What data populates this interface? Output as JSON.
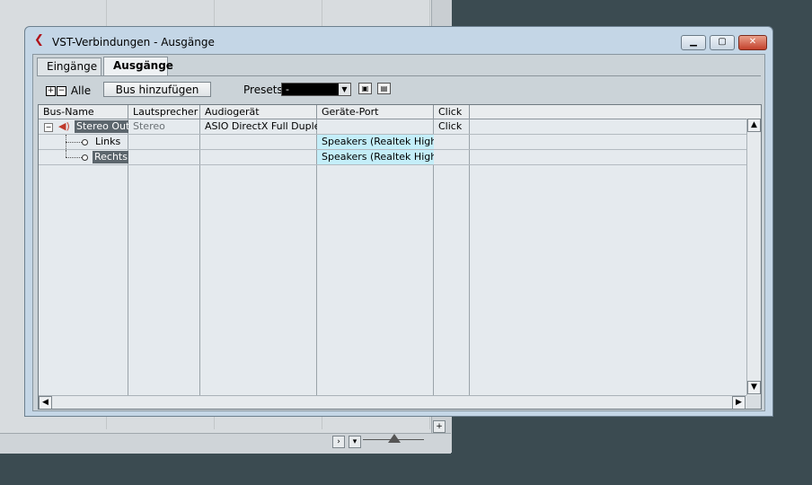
{
  "window": {
    "title": "VST-Verbindungen - Ausgänge",
    "title_icon": "cubase-logo-icon",
    "controls": {
      "minimize": "minimize-icon",
      "maximize": "maximize-icon",
      "close": "close-icon"
    }
  },
  "tabs": [
    {
      "label": "Eingänge",
      "active": false
    },
    {
      "label": "Ausgänge",
      "active": true
    }
  ],
  "toolbar": {
    "expand_all_label": "Alle",
    "add_bus_label": "Bus hinzufügen",
    "presets_label": "Presets",
    "presets_value": "-"
  },
  "table": {
    "columns": [
      "Bus-Name",
      "Lautsprecher",
      "Audiogerät",
      "Geräte-Port",
      "Click"
    ],
    "rows": [
      {
        "bus_name": "Stereo Out",
        "speakers": "Stereo",
        "device": "ASIO DirectX Full Duplex",
        "port": "",
        "click": "Click"
      },
      {
        "bus_name": "Links",
        "speakers": "",
        "device": "",
        "port": "Speakers (Realtek High D",
        "click": ""
      },
      {
        "bus_name": "Rechts",
        "speakers": "",
        "device": "",
        "port": "Speakers (Realtek High D",
        "click": ""
      }
    ]
  },
  "colors": {
    "desktop": "#3b4b51",
    "window_frame": "#c4d6e6",
    "port_cell": "#c4eef9",
    "selected_name": "#5c666d"
  }
}
